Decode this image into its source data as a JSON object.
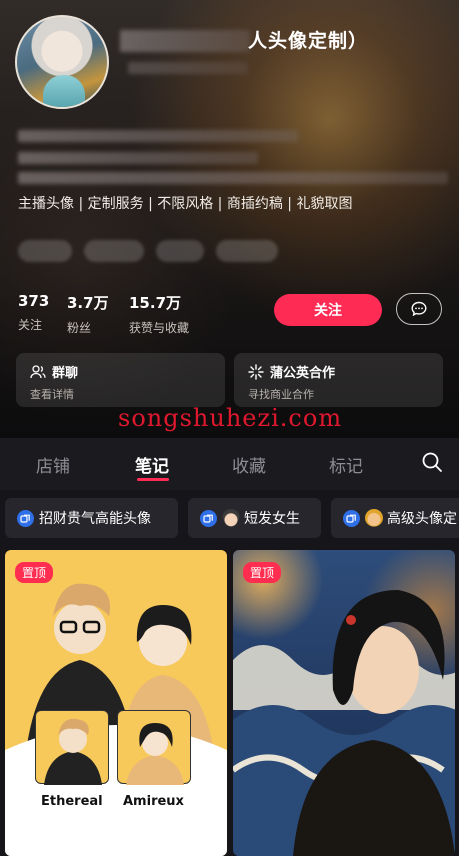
{
  "profile": {
    "name_visible": "人头像定制）",
    "tags_line": "主播头像 | 定制服务 | 不限风格 | 商插约稿 | 礼貌取图"
  },
  "stats": [
    {
      "value": "373",
      "label": "关注"
    },
    {
      "value": "3.7万",
      "label": "粉丝"
    },
    {
      "value": "15.7万",
      "label": "获赞与收藏"
    }
  ],
  "actions": {
    "follow_label": "关注"
  },
  "cards": [
    {
      "title": "群聊",
      "sub": "查看详情",
      "icon": "group-icon"
    },
    {
      "title": "蒲公英合作",
      "sub": "寻找商业合作",
      "icon": "sparkle-icon"
    }
  ],
  "watermark": "songshuhezi.com",
  "tabs": [
    {
      "label": "店铺",
      "active": false
    },
    {
      "label": "笔记",
      "active": true
    },
    {
      "label": "收藏",
      "active": false
    },
    {
      "label": "标记",
      "active": false
    }
  ],
  "collections": [
    {
      "label": "招财贵气高能头像"
    },
    {
      "label": "短发女生"
    },
    {
      "label": "高级头像定"
    }
  ],
  "posts": [
    {
      "badge": "置顶",
      "labels": [
        "Ethereal",
        "Amireux"
      ]
    },
    {
      "badge": "置顶"
    }
  ],
  "colors": {
    "accent": "#fe2c55",
    "background": "#15151a",
    "collection_icon": "#2f6fe8"
  }
}
